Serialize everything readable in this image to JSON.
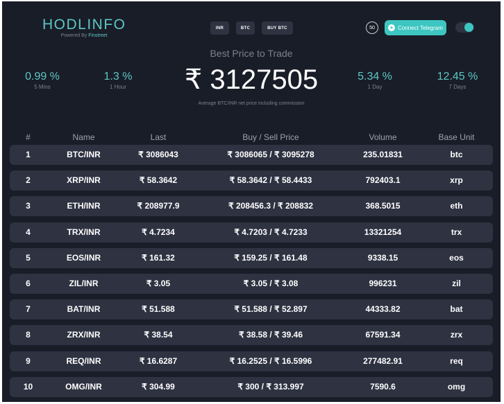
{
  "brand": {
    "title": "HODLINFO",
    "powered_by": "Powered By",
    "powered_name": "Finstreet"
  },
  "header": {
    "inr_label": "INR",
    "btc_label": "BTC",
    "buy_btc_label": "BUY BTC",
    "timer": "50",
    "telegram_label": "Connect Telegram",
    "theme_toggle_on": true
  },
  "best": {
    "title": "Best Price to Trade",
    "price": "₹ 3127505",
    "note": "Average BTC/INR net price including commission"
  },
  "stats": [
    {
      "value": "0.99 %",
      "label": "5 Mins"
    },
    {
      "value": "1.3 %",
      "label": "1 Hour"
    },
    {
      "value": "5.34 %",
      "label": "1 Day"
    },
    {
      "value": "12.45 %",
      "label": "7 Days"
    }
  ],
  "table": {
    "columns": [
      "#",
      "Name",
      "Last",
      "Buy / Sell Price",
      "Volume",
      "Base Unit"
    ],
    "rows": [
      [
        "1",
        "BTC/INR",
        "₹ 3086043",
        "₹ 3086065 / ₹ 3095278",
        "235.01831",
        "btc"
      ],
      [
        "2",
        "XRP/INR",
        "₹ 58.3642",
        "₹ 58.3642 / ₹ 58.4433",
        "792403.1",
        "xrp"
      ],
      [
        "3",
        "ETH/INR",
        "₹ 208977.9",
        "₹ 208456.3 / ₹ 208832",
        "368.5015",
        "eth"
      ],
      [
        "4",
        "TRX/INR",
        "₹ 4.7234",
        "₹ 4.7203 / ₹ 4.7233",
        "13321254",
        "trx"
      ],
      [
        "5",
        "EOS/INR",
        "₹ 161.32",
        "₹ 159.25 / ₹ 161.48",
        "9338.15",
        "eos"
      ],
      [
        "6",
        "ZIL/INR",
        "₹ 3.05",
        "₹ 3.05 / ₹ 3.08",
        "996231",
        "zil"
      ],
      [
        "7",
        "BAT/INR",
        "₹ 51.588",
        "₹ 51.588 / ₹ 52.897",
        "44333.82",
        "bat"
      ],
      [
        "8",
        "ZRX/INR",
        "₹ 38.54",
        "₹ 38.58 / ₹ 39.46",
        "67591.34",
        "zrx"
      ],
      [
        "9",
        "REQ/INR",
        "₹ 16.6287",
        "₹ 16.2525 / ₹ 16.5996",
        "277482.91",
        "req"
      ],
      [
        "10",
        "OMG/INR",
        "₹ 304.99",
        "₹ 300 / ₹ 313.997",
        "7590.6",
        "omg"
      ]
    ]
  },
  "colors": {
    "background": "#191d28",
    "accent": "#3dc6c1",
    "row": "#2e3241",
    "muted": "#7b818c"
  },
  "icons": {
    "telegram": "telegram-icon"
  }
}
